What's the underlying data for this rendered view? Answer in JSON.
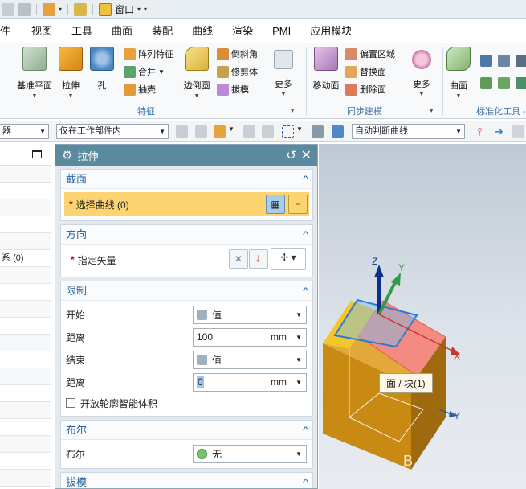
{
  "quick_access": {
    "window_menu": "窗口"
  },
  "menubar": [
    "件",
    "视图",
    "工具",
    "曲面",
    "装配",
    "曲线",
    "渲染",
    "PMI",
    "应用模块"
  ],
  "ribbon": {
    "big_buttons": [
      {
        "id": "datum-plane",
        "label": "基准平面"
      },
      {
        "id": "extrude",
        "label": "拉伸"
      },
      {
        "id": "hole",
        "label": "孔"
      },
      {
        "id": "edge-blend",
        "label": "边倒圆"
      },
      {
        "id": "more1",
        "label": "更多"
      },
      {
        "id": "move-face",
        "label": "移动面"
      },
      {
        "id": "more2",
        "label": "更多"
      },
      {
        "id": "surface",
        "label": "曲面"
      }
    ],
    "small_buttons": [
      {
        "id": "pattern-feature",
        "label": "阵列特征"
      },
      {
        "id": "unite",
        "label": "合并"
      },
      {
        "id": "shell",
        "label": "抽壳"
      },
      {
        "id": "chamfer",
        "label": "倒斜角"
      },
      {
        "id": "trim-body",
        "label": "修剪体"
      },
      {
        "id": "draft",
        "label": "拔模"
      },
      {
        "id": "offset-region",
        "label": "偏置区域"
      },
      {
        "id": "replace-face",
        "label": "替换面"
      },
      {
        "id": "delete-face",
        "label": "删除面"
      }
    ],
    "groups": {
      "feature": "特征",
      "sync": "同步建模",
      "standard": "标准化工具 -"
    }
  },
  "selbar": {
    "filter_value": "器",
    "scope_value": "仅在工作部件内",
    "curve_rule": "自动判断曲线"
  },
  "navigator": {
    "row_text": "(0)"
  },
  "dialog": {
    "title": "拉伸",
    "section_section": "截面",
    "select_curve": "选择曲线 (0)",
    "section_direction": "方向",
    "specify_vector": "指定矢量",
    "section_limits": "限制",
    "start_label": "开始",
    "start_value": "值",
    "distance1_label": "距离",
    "distance1_value": "100",
    "unit": "mm",
    "end_label": "结束",
    "end_value": "值",
    "distance2_label": "距离",
    "distance2_value": "0",
    "open_profile": "开放轮廓智能体积",
    "section_boolean": "布尔",
    "boolean_label": "布尔",
    "boolean_value": "无",
    "section_draft": "拔模"
  },
  "graphics": {
    "axis_x": "X",
    "axis_y": "Y",
    "axis_z": "Z",
    "tooltip": "面 / 块(1)",
    "corner_text": "B"
  },
  "colors": {
    "title_bar": "#5b8a9e",
    "section_head": "#2a67a2",
    "highlight": "#fcd572",
    "face_highlight": "#f28b82",
    "block": "#c88a13"
  }
}
